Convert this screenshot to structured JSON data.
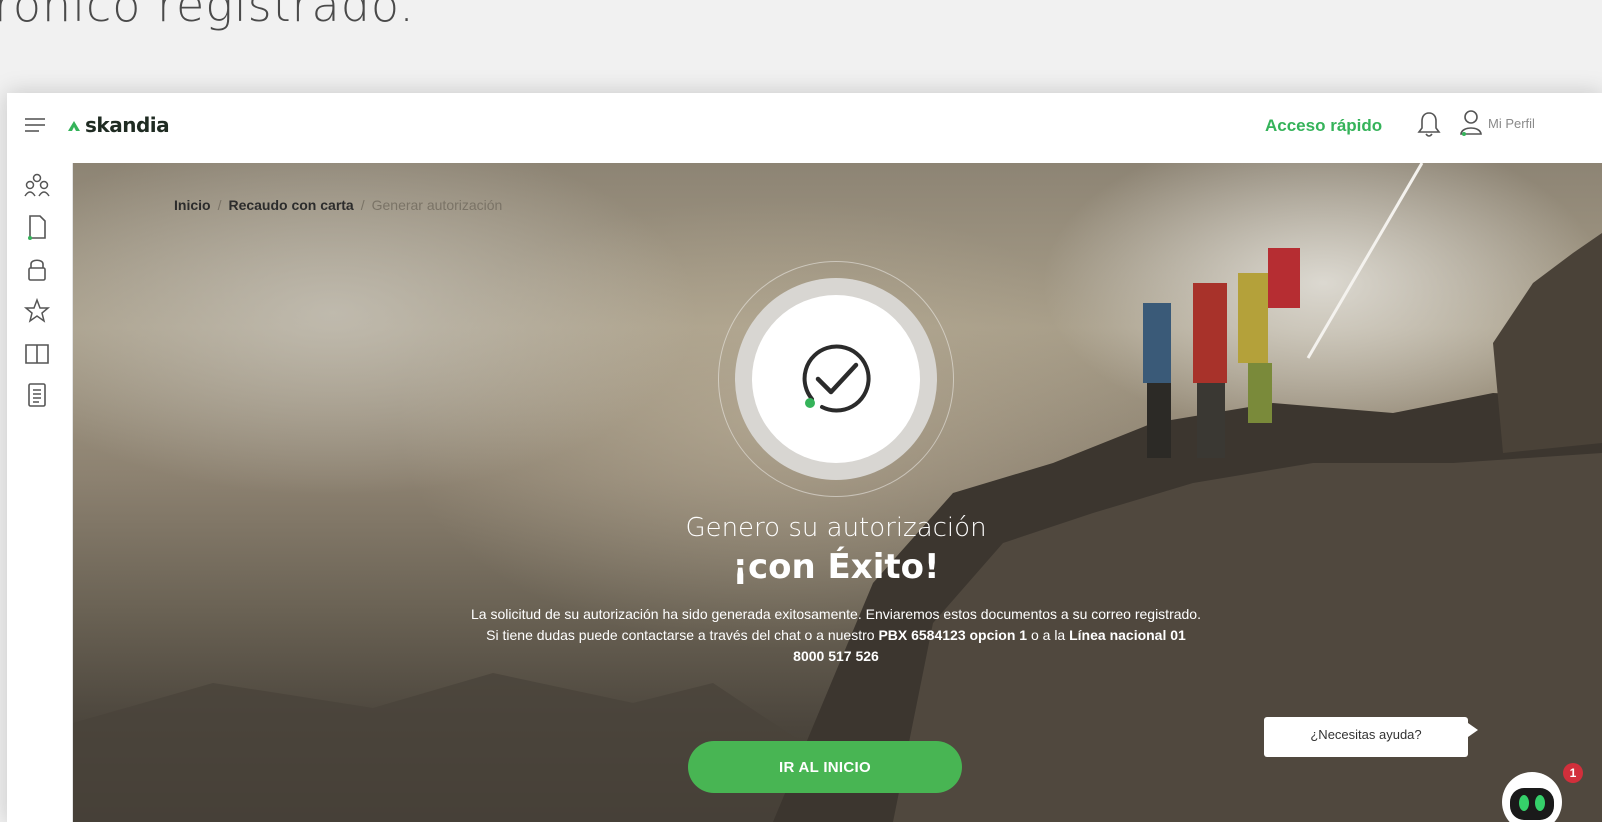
{
  "caption": "rónico registrado.",
  "header": {
    "brand": "skandia",
    "quick_access": "Acceso rápido",
    "profile_label": "Mi Perfil",
    "accent_color": "#35b35a"
  },
  "sidebar": {
    "items": [
      {
        "icon": "group-icon"
      },
      {
        "icon": "document-icon"
      },
      {
        "icon": "lock-icon"
      },
      {
        "icon": "star-icon"
      },
      {
        "icon": "book-icon"
      },
      {
        "icon": "notes-icon"
      }
    ]
  },
  "breadcrumb": {
    "home": "Inicio",
    "section": "Recaudo con carta",
    "current": "Generar autorización",
    "separator": "/"
  },
  "success": {
    "title_line1": "Genero su autorización",
    "title_line2": "¡con Éxito!",
    "message_part1": "La solicitud de su autorización ha sido generada exitosamente. Enviaremos estos documentos a su correo registrado. Si tiene dudas puede contactarse a través del chat o a nuestro",
    "message_pbx": "PBX 6584123 opcion 1",
    "message_part2": "o a la",
    "message_line": "Línea nacional 01 8000 517 526",
    "button_label": "IR AL INICIO",
    "button_color": "#48b553"
  },
  "help": {
    "bubble_text": "¿Necesitas ayuda?",
    "badge_count": "1"
  }
}
